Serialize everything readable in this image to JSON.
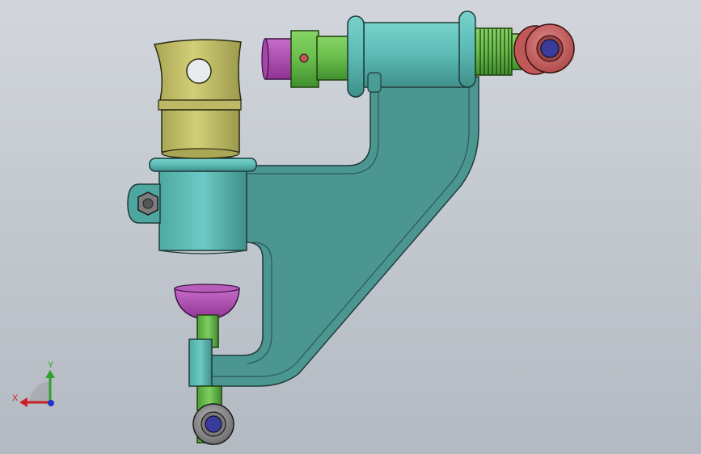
{
  "viewport": {
    "background_top": "#d2d6dc",
    "background_bottom": "#b4bac2"
  },
  "model": {
    "colors": {
      "arm_teal": "#4e9a95",
      "arm_teal_light": "#5fb3ad",
      "cylinder_teal": "#66c4be",
      "bushing_yellow": "#c9c56e",
      "shaft_green": "#6bc04e",
      "thread_green": "#7cc85a",
      "pin_magenta": "#b04db4",
      "rod_end_red": "#d46a6a",
      "ball_blue": "#3a3c9c",
      "nut_gray": "#8e8e8e"
    },
    "parts": [
      "control-arm",
      "bushing-sleeve",
      "pivot-shaft",
      "threaded-end",
      "rod-end-top",
      "clamp-bolt",
      "rubber-boot",
      "ball-joint-stud",
      "rod-end-bottom"
    ]
  },
  "triad": {
    "y_label": "Y",
    "x_label": "X",
    "y_color": "#2ea02e",
    "x_color": "#cc2222",
    "z_color": "#2233cc"
  }
}
